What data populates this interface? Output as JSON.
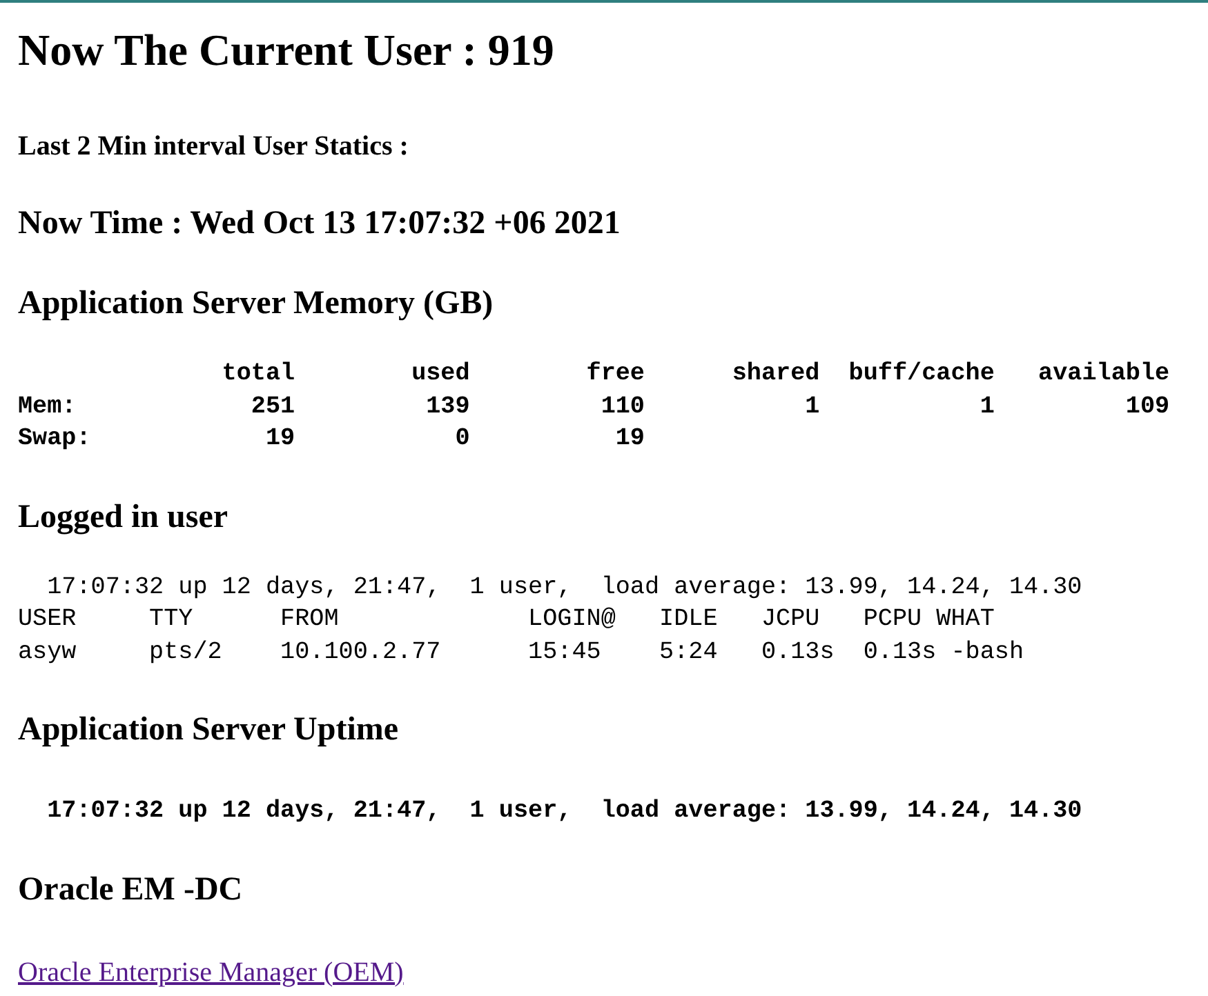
{
  "title": "Now The Current User : 919",
  "subtitle": "Last 2 Min interval User Statics :",
  "sections": [
    {
      "kind": "heading",
      "text": "Now Time : Wed Oct 13 17:07:32 +06 2021"
    },
    {
      "kind": "heading",
      "text": "Application Server Memory (GB)"
    },
    {
      "kind": "output",
      "bold": true,
      "lines": [
        "              total        used        free      shared  buff/cache   available",
        "Mem:            251         139         110           1           1         109",
        "Swap:            19           0          19"
      ]
    },
    {
      "kind": "heading",
      "text": "Logged in user"
    },
    {
      "kind": "output",
      "bold": false,
      "lines": [
        "  17:07:32 up 12 days, 21:47,  1 user,  load average: 13.99, 14.24, 14.30",
        "USER     TTY      FROM             LOGIN@   IDLE   JCPU   PCPU WHAT",
        "asyw     pts/2    10.100.2.77      15:45    5:24   0.13s  0.13s -bash"
      ]
    },
    {
      "kind": "heading",
      "text": "Application Server Uptime"
    },
    {
      "kind": "output",
      "bold": true,
      "lines": [
        "  17:07:32 up 12 days, 21:47,  1 user,  load average: 13.99, 14.24, 14.30"
      ]
    },
    {
      "kind": "heading",
      "text": "Oracle EM -DC"
    },
    {
      "kind": "link",
      "text": "Oracle Enterprise Manager (OEM)"
    }
  ]
}
